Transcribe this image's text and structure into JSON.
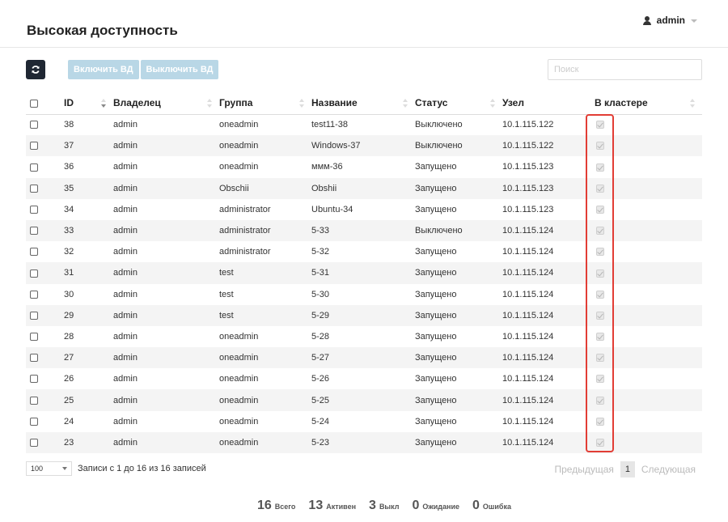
{
  "header": {
    "title": "Высокая доступность",
    "user": "admin"
  },
  "toolbar": {
    "enable_label": "Включить ВД",
    "disable_label": "Выключить ВД",
    "search_placeholder": "Поиск"
  },
  "columns": [
    "ID",
    "Владелец",
    "Группа",
    "Название",
    "Статус",
    "Узел",
    "В кластере"
  ],
  "rows": [
    {
      "id": "38",
      "owner": "admin",
      "group": "oneadmin",
      "name": "test11-38",
      "status": "Выключено",
      "node": "10.1.115.122",
      "in_cluster": true
    },
    {
      "id": "37",
      "owner": "admin",
      "group": "oneadmin",
      "name": "Windows-37",
      "status": "Выключено",
      "node": "10.1.115.122",
      "in_cluster": true
    },
    {
      "id": "36",
      "owner": "admin",
      "group": "oneadmin",
      "name": "ммм-36",
      "status": "Запущено",
      "node": "10.1.115.123",
      "in_cluster": true
    },
    {
      "id": "35",
      "owner": "admin",
      "group": "Obschii",
      "name": "Obshii",
      "status": "Запущено",
      "node": "10.1.115.123",
      "in_cluster": true
    },
    {
      "id": "34",
      "owner": "admin",
      "group": "administrator",
      "name": "Ubuntu-34",
      "status": "Запущено",
      "node": "10.1.115.123",
      "in_cluster": true
    },
    {
      "id": "33",
      "owner": "admin",
      "group": "administrator",
      "name": "5-33",
      "status": "Выключено",
      "node": "10.1.115.124",
      "in_cluster": true
    },
    {
      "id": "32",
      "owner": "admin",
      "group": "administrator",
      "name": "5-32",
      "status": "Запущено",
      "node": "10.1.115.124",
      "in_cluster": true
    },
    {
      "id": "31",
      "owner": "admin",
      "group": "test",
      "name": "5-31",
      "status": "Запущено",
      "node": "10.1.115.124",
      "in_cluster": true
    },
    {
      "id": "30",
      "owner": "admin",
      "group": "test",
      "name": "5-30",
      "status": "Запущено",
      "node": "10.1.115.124",
      "in_cluster": true
    },
    {
      "id": "29",
      "owner": "admin",
      "group": "test",
      "name": "5-29",
      "status": "Запущено",
      "node": "10.1.115.124",
      "in_cluster": true
    },
    {
      "id": "28",
      "owner": "admin",
      "group": "oneadmin",
      "name": "5-28",
      "status": "Запущено",
      "node": "10.1.115.124",
      "in_cluster": true
    },
    {
      "id": "27",
      "owner": "admin",
      "group": "oneadmin",
      "name": "5-27",
      "status": "Запущено",
      "node": "10.1.115.124",
      "in_cluster": true
    },
    {
      "id": "26",
      "owner": "admin",
      "group": "oneadmin",
      "name": "5-26",
      "status": "Запущено",
      "node": "10.1.115.124",
      "in_cluster": true
    },
    {
      "id": "25",
      "owner": "admin",
      "group": "oneadmin",
      "name": "5-25",
      "status": "Запущено",
      "node": "10.1.115.124",
      "in_cluster": true
    },
    {
      "id": "24",
      "owner": "admin",
      "group": "oneadmin",
      "name": "5-24",
      "status": "Запущено",
      "node": "10.1.115.124",
      "in_cluster": true
    },
    {
      "id": "23",
      "owner": "admin",
      "group": "oneadmin",
      "name": "5-23",
      "status": "Запущено",
      "node": "10.1.115.124",
      "in_cluster": true
    }
  ],
  "footer": {
    "page_length": "100",
    "info": "Записи с 1 до 16 из 16 записей",
    "prev_label": "Предыдущая",
    "page": "1",
    "next_label": "Следующая"
  },
  "summary": [
    {
      "num": "16",
      "label": "Всего"
    },
    {
      "num": "13",
      "label": "Активен"
    },
    {
      "num": "3",
      "label": "Выкл"
    },
    {
      "num": "0",
      "label": "Ожидание"
    },
    {
      "num": "0",
      "label": "Ошибка"
    }
  ],
  "colors": {
    "highlight": "#e23d35",
    "refresh_bg": "#1f2733",
    "disabled_button": "#b9d7e6"
  }
}
